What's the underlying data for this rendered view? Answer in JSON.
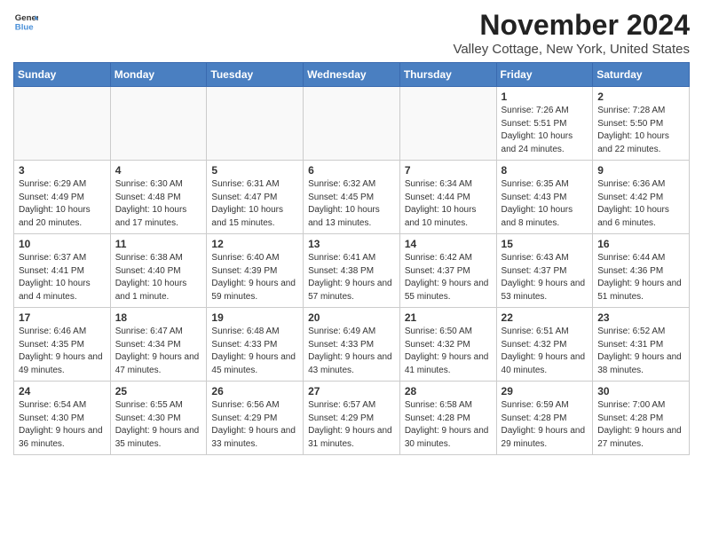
{
  "header": {
    "logo_line1": "General",
    "logo_line2": "Blue",
    "month": "November 2024",
    "location": "Valley Cottage, New York, United States"
  },
  "weekdays": [
    "Sunday",
    "Monday",
    "Tuesday",
    "Wednesday",
    "Thursday",
    "Friday",
    "Saturday"
  ],
  "weeks": [
    [
      {
        "day": "",
        "info": "",
        "empty": true
      },
      {
        "day": "",
        "info": "",
        "empty": true
      },
      {
        "day": "",
        "info": "",
        "empty": true
      },
      {
        "day": "",
        "info": "",
        "empty": true
      },
      {
        "day": "",
        "info": "",
        "empty": true
      },
      {
        "day": "1",
        "info": "Sunrise: 7:26 AM\nSunset: 5:51 PM\nDaylight: 10 hours and 24 minutes.",
        "empty": false
      },
      {
        "day": "2",
        "info": "Sunrise: 7:28 AM\nSunset: 5:50 PM\nDaylight: 10 hours and 22 minutes.",
        "empty": false
      }
    ],
    [
      {
        "day": "3",
        "info": "Sunrise: 6:29 AM\nSunset: 4:49 PM\nDaylight: 10 hours and 20 minutes.",
        "empty": false
      },
      {
        "day": "4",
        "info": "Sunrise: 6:30 AM\nSunset: 4:48 PM\nDaylight: 10 hours and 17 minutes.",
        "empty": false
      },
      {
        "day": "5",
        "info": "Sunrise: 6:31 AM\nSunset: 4:47 PM\nDaylight: 10 hours and 15 minutes.",
        "empty": false
      },
      {
        "day": "6",
        "info": "Sunrise: 6:32 AM\nSunset: 4:45 PM\nDaylight: 10 hours and 13 minutes.",
        "empty": false
      },
      {
        "day": "7",
        "info": "Sunrise: 6:34 AM\nSunset: 4:44 PM\nDaylight: 10 hours and 10 minutes.",
        "empty": false
      },
      {
        "day": "8",
        "info": "Sunrise: 6:35 AM\nSunset: 4:43 PM\nDaylight: 10 hours and 8 minutes.",
        "empty": false
      },
      {
        "day": "9",
        "info": "Sunrise: 6:36 AM\nSunset: 4:42 PM\nDaylight: 10 hours and 6 minutes.",
        "empty": false
      }
    ],
    [
      {
        "day": "10",
        "info": "Sunrise: 6:37 AM\nSunset: 4:41 PM\nDaylight: 10 hours and 4 minutes.",
        "empty": false
      },
      {
        "day": "11",
        "info": "Sunrise: 6:38 AM\nSunset: 4:40 PM\nDaylight: 10 hours and 1 minute.",
        "empty": false
      },
      {
        "day": "12",
        "info": "Sunrise: 6:40 AM\nSunset: 4:39 PM\nDaylight: 9 hours and 59 minutes.",
        "empty": false
      },
      {
        "day": "13",
        "info": "Sunrise: 6:41 AM\nSunset: 4:38 PM\nDaylight: 9 hours and 57 minutes.",
        "empty": false
      },
      {
        "day": "14",
        "info": "Sunrise: 6:42 AM\nSunset: 4:37 PM\nDaylight: 9 hours and 55 minutes.",
        "empty": false
      },
      {
        "day": "15",
        "info": "Sunrise: 6:43 AM\nSunset: 4:37 PM\nDaylight: 9 hours and 53 minutes.",
        "empty": false
      },
      {
        "day": "16",
        "info": "Sunrise: 6:44 AM\nSunset: 4:36 PM\nDaylight: 9 hours and 51 minutes.",
        "empty": false
      }
    ],
    [
      {
        "day": "17",
        "info": "Sunrise: 6:46 AM\nSunset: 4:35 PM\nDaylight: 9 hours and 49 minutes.",
        "empty": false
      },
      {
        "day": "18",
        "info": "Sunrise: 6:47 AM\nSunset: 4:34 PM\nDaylight: 9 hours and 47 minutes.",
        "empty": false
      },
      {
        "day": "19",
        "info": "Sunrise: 6:48 AM\nSunset: 4:33 PM\nDaylight: 9 hours and 45 minutes.",
        "empty": false
      },
      {
        "day": "20",
        "info": "Sunrise: 6:49 AM\nSunset: 4:33 PM\nDaylight: 9 hours and 43 minutes.",
        "empty": false
      },
      {
        "day": "21",
        "info": "Sunrise: 6:50 AM\nSunset: 4:32 PM\nDaylight: 9 hours and 41 minutes.",
        "empty": false
      },
      {
        "day": "22",
        "info": "Sunrise: 6:51 AM\nSunset: 4:32 PM\nDaylight: 9 hours and 40 minutes.",
        "empty": false
      },
      {
        "day": "23",
        "info": "Sunrise: 6:52 AM\nSunset: 4:31 PM\nDaylight: 9 hours and 38 minutes.",
        "empty": false
      }
    ],
    [
      {
        "day": "24",
        "info": "Sunrise: 6:54 AM\nSunset: 4:30 PM\nDaylight: 9 hours and 36 minutes.",
        "empty": false
      },
      {
        "day": "25",
        "info": "Sunrise: 6:55 AM\nSunset: 4:30 PM\nDaylight: 9 hours and 35 minutes.",
        "empty": false
      },
      {
        "day": "26",
        "info": "Sunrise: 6:56 AM\nSunset: 4:29 PM\nDaylight: 9 hours and 33 minutes.",
        "empty": false
      },
      {
        "day": "27",
        "info": "Sunrise: 6:57 AM\nSunset: 4:29 PM\nDaylight: 9 hours and 31 minutes.",
        "empty": false
      },
      {
        "day": "28",
        "info": "Sunrise: 6:58 AM\nSunset: 4:28 PM\nDaylight: 9 hours and 30 minutes.",
        "empty": false
      },
      {
        "day": "29",
        "info": "Sunrise: 6:59 AM\nSunset: 4:28 PM\nDaylight: 9 hours and 29 minutes.",
        "empty": false
      },
      {
        "day": "30",
        "info": "Sunrise: 7:00 AM\nSunset: 4:28 PM\nDaylight: 9 hours and 27 minutes.",
        "empty": false
      }
    ]
  ]
}
